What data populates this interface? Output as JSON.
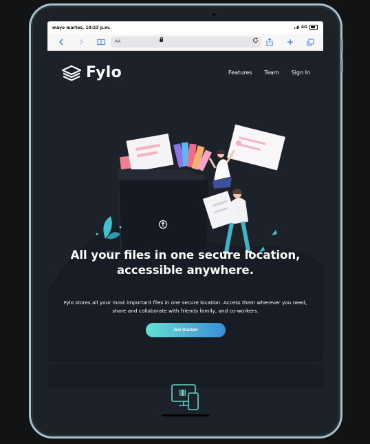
{
  "status_bar": {
    "time": "mayo martes, 10:23 p.m.",
    "network": "4G"
  },
  "browser": {
    "reader_label": "AA",
    "icons": [
      "back-icon",
      "forward-icon",
      "bookmarks-icon",
      "lock-icon",
      "reload-icon",
      "share-icon",
      "new-tab-icon",
      "tabs-icon"
    ]
  },
  "site": {
    "brand": "Fylo",
    "nav": [
      "Features",
      "Team",
      "Sign In"
    ],
    "headline_line1": "All your files in one secure location,",
    "headline_line2": "accessible anywhere.",
    "lead": "Fylo stores all your most important files in one secure location. Access them wherever you need, share and collaborate with friends family, and co-workers.",
    "cta": "Get Started"
  },
  "colors": {
    "page_bg": "#1c212a",
    "cta_start": "#63e0d2",
    "cta_end": "#3a8ed7",
    "accent_teal": "#5fd8cf"
  }
}
